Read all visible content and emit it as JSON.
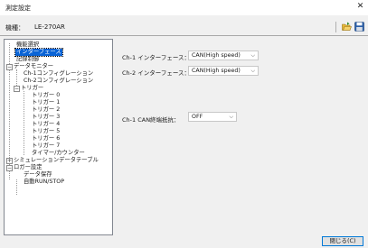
{
  "window": {
    "title": "測定設定",
    "close_glyph": "✕"
  },
  "model": {
    "label": "機種：",
    "value": "LE-270AR"
  },
  "toolbar": {
    "open_icon": "open-folder-icon",
    "save_icon": "floppy-disk-icon"
  },
  "tree": {
    "items": [
      {
        "label": "機能選択"
      },
      {
        "label": "インターフェース",
        "selected": true
      },
      {
        "label": "記録制御"
      },
      {
        "label": "データモニター",
        "expander": "−"
      },
      {
        "label": "Ch-1コンフィグレーション"
      },
      {
        "label": "Ch-2コンフィグレーション"
      },
      {
        "label": "トリガー",
        "expander": "−"
      },
      {
        "label": "トリガー 0"
      },
      {
        "label": "トリガー 1"
      },
      {
        "label": "トリガー 2"
      },
      {
        "label": "トリガー 3"
      },
      {
        "label": "トリガー 4"
      },
      {
        "label": "トリガー 5"
      },
      {
        "label": "トリガー 6"
      },
      {
        "label": "トリガー 7"
      },
      {
        "label": "タイマー/カウンター"
      },
      {
        "label": "シミュレーションデータテーブル",
        "expander": "+"
      },
      {
        "label": "ロガー設定",
        "expander": "−"
      },
      {
        "label": "データ保存"
      },
      {
        "label": "自動RUN/STOP"
      }
    ]
  },
  "settings": {
    "ch1_interface": {
      "label": "Ch-1 インターフェース：",
      "value": "CAN(High speed)"
    },
    "ch2_interface": {
      "label": "Ch-2 インターフェース：",
      "value": "CAN(High speed)"
    },
    "ch1_termination": {
      "label": "Ch-1 CAN終端抵抗：",
      "value": "OFF"
    },
    "dropdown_arrow": "⌵"
  },
  "buttons": {
    "close_label": "閉じる(C)"
  }
}
